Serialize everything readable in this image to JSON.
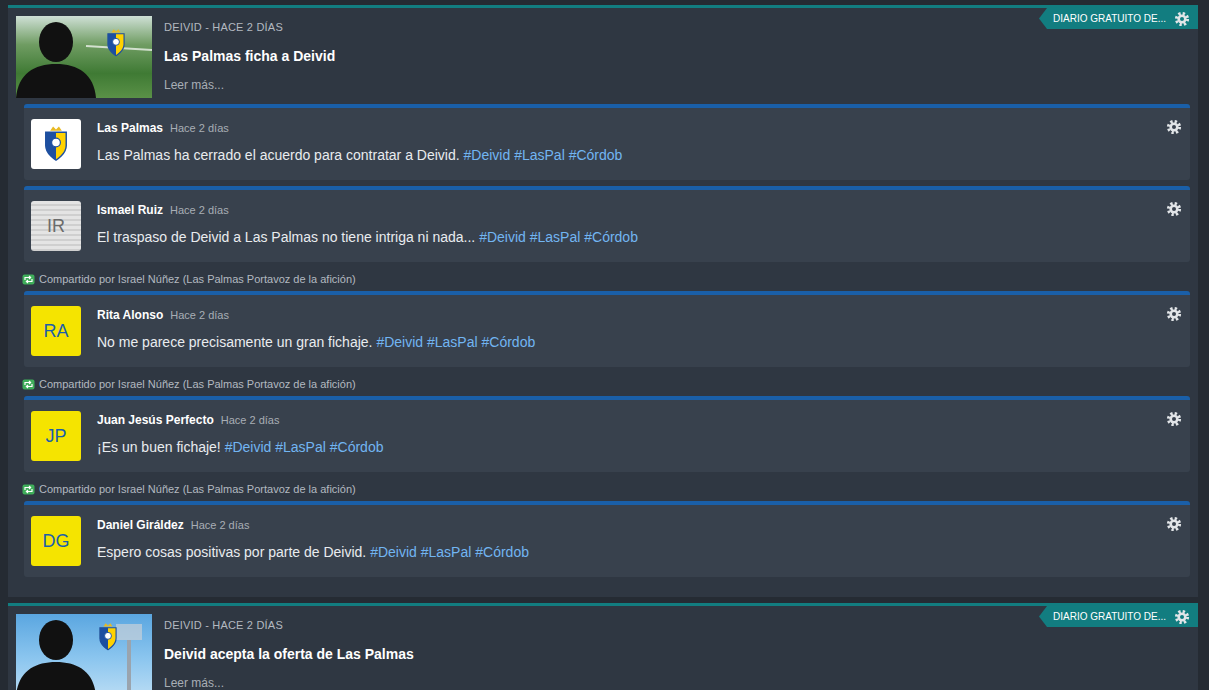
{
  "articles": [
    {
      "byline": "DEIVID - HACE 2 DÍAS",
      "title": "Las Palmas ficha a Deivid",
      "read_more": "Leer más...",
      "source": "DIARIO GRATUITO DE...",
      "image_kind": "pitch",
      "posts": [
        {
          "author": "Las Palmas",
          "time": "Hace 2 días",
          "avatar": {
            "kind": "logo"
          },
          "text": "Las Palmas ha cerrado el acuerdo para contratar a Deivid.",
          "hashtags": [
            "#Deivid",
            "#LasPal",
            "#Córdob"
          ]
        },
        {
          "author": "Ismael Ruiz",
          "time": "Hace 2 días",
          "avatar": {
            "kind": "striped",
            "initials": "IR",
            "color": "#dcdcdc"
          },
          "text": "El traspaso de Deivid a Las Palmas no tiene intriga ni nada...",
          "hashtags": [
            "#Deivid",
            "#LasPal",
            "#Córdob"
          ]
        },
        {
          "shared_by": "Compartido por Israel Núñez (Las Palmas Portavoz de la afición)",
          "author": "Rita Alonso",
          "time": "Hace 2 días",
          "avatar": {
            "kind": "fan",
            "initials": "RA",
            "color": "#f5e400"
          },
          "text": "No me parece precisamente un gran fichaje.",
          "hashtags": [
            "#Deivid",
            "#LasPal",
            "#Córdob"
          ]
        },
        {
          "shared_by": "Compartido por Israel Núñez (Las Palmas Portavoz de la afición)",
          "author": "Juan Jesús Perfecto",
          "time": "Hace 2 días",
          "avatar": {
            "kind": "fan",
            "initials": "JP",
            "color": "#f5e400"
          },
          "text": "¡Es un buen fichaje!",
          "hashtags": [
            "#Deivid",
            "#LasPal",
            "#Córdob"
          ]
        },
        {
          "shared_by": "Compartido por Israel Núñez (Las Palmas Portavoz de la afición)",
          "author": "Daniel Giráldez",
          "time": "Hace 2 días",
          "avatar": {
            "kind": "fan",
            "initials": "DG",
            "color": "#f5e400"
          },
          "text": "Espero cosas positivas por parte de Deivid.",
          "hashtags": [
            "#Deivid",
            "#LasPal",
            "#Córdob"
          ]
        }
      ]
    },
    {
      "byline": "DEIVID - HACE 2 DÍAS",
      "title": "Deivid acepta la oferta de Las Palmas",
      "read_more": "Leer más...",
      "source": "DIARIO GRATUITO DE...",
      "image_kind": "stadium",
      "posts": []
    }
  ]
}
